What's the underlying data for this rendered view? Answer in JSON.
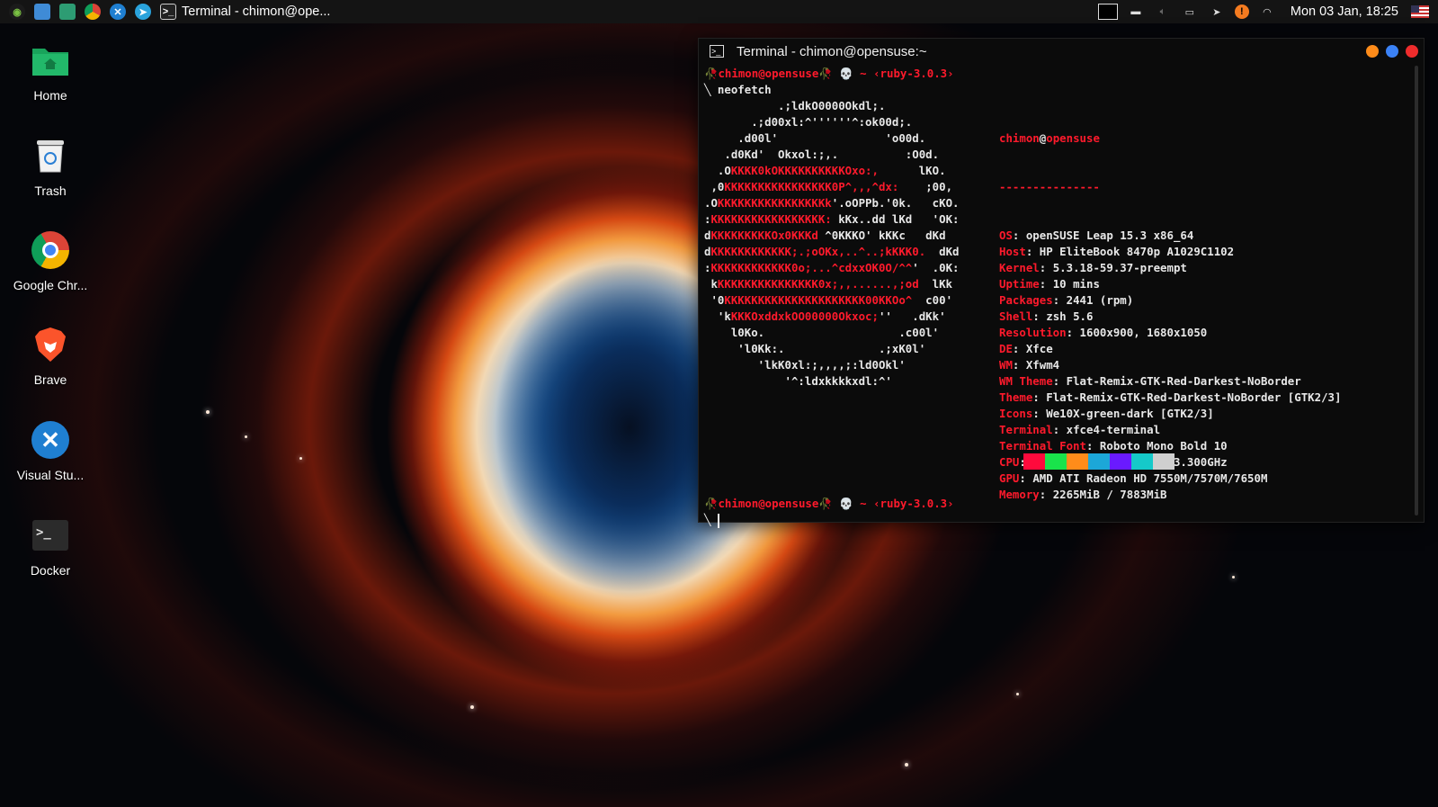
{
  "taskbar": {
    "task_title": "Terminal - chimon@ope...",
    "clock": "Mon 03 Jan, 18:25",
    "launchers": [
      "opensuse-icon",
      "file-manager-icon",
      "software-icon",
      "chrome-icon",
      "vscode-icon",
      "telegram-icon",
      "terminal-icon"
    ],
    "tray": [
      "window-icon",
      "screen-icon",
      "volume-icon",
      "battery-icon",
      "send-icon",
      "update-alert-icon",
      "wifi-icon"
    ]
  },
  "desktop": {
    "icons": [
      {
        "label": "Home",
        "icon": "folder-home-icon"
      },
      {
        "label": "Trash",
        "icon": "trash-icon"
      },
      {
        "label": "Google Chr...",
        "icon": "chrome-icon"
      },
      {
        "label": "Brave",
        "icon": "brave-icon"
      },
      {
        "label": "Visual Stu...",
        "icon": "vscode-icon"
      },
      {
        "label": "Docker",
        "icon": "terminal-app-icon"
      }
    ]
  },
  "terminal": {
    "title": "Terminal - chimon@opensuse:~",
    "prompt": {
      "user": "chimon@opensuse",
      "path": "~",
      "ruby": "‹ruby-3.0.3›",
      "command": "neofetch"
    },
    "ascii_lines": [
      "           .;ldkO0000Okdl;.",
      "       .;d00xl:^''''''^:ok00d;.",
      "     .d00l'                'o00d.",
      "   .d0Kd'  Okxol:;,.          :O0d.",
      "  .OKKKK0kOKKKKKKKKKKOxo:,      lKO.",
      " ,0KKKKKKKKKKKKKKKK0P^,,,^dx:    ;00,",
      ".OKKKKKKKKKKKKKKKKk'.oOPPb.'0k.   cKO.",
      ":KKKKKKKKKKKKKKKKK: kKx..dd lKd   'OK:",
      "dKKKKKKKKKOx0KKKd ^0KKKO' kKKc   dKd",
      "dKKKKKKKKKKKK;.;oOKx,..^..;kKKK0.  dKd",
      ":KKKKKKKKKKKK0o;...^cdxxOK0O/^^'  .0K:",
      " kKKKKKKKKKKKKKKK0x;,,......,;od  lKk",
      " '0KKKKKKKKKKKKKKKKKKKKK00KKOo^  c00'",
      "  'kKKKOxddxkOO00000Okxoc;''   .dKk'",
      "    l0Ko.                    .c00l'",
      "     'l0Kk:.              .;xK0l'",
      "        'lkK0xl:;,,,,;:ld0Okl'",
      "            '^:ldxkkkkxdl:^'"
    ],
    "info": {
      "header_user": "chimon",
      "header_host": "opensuse",
      "separator": "---------------",
      "rows": [
        {
          "key": "OS",
          "value": "openSUSE Leap 15.3 x86_64"
        },
        {
          "key": "Host",
          "value": "HP EliteBook 8470p A1029C1102"
        },
        {
          "key": "Kernel",
          "value": "5.3.18-59.37-preempt"
        },
        {
          "key": "Uptime",
          "value": "10 mins"
        },
        {
          "key": "Packages",
          "value": "2441 (rpm)"
        },
        {
          "key": "Shell",
          "value": "zsh 5.6"
        },
        {
          "key": "Resolution",
          "value": "1600x900, 1680x1050"
        },
        {
          "key": "DE",
          "value": "Xfce"
        },
        {
          "key": "WM",
          "value": "Xfwm4"
        },
        {
          "key": "WM Theme",
          "value": "Flat-Remix-GTK-Red-Darkest-NoBorder"
        },
        {
          "key": "Theme",
          "value": "Flat-Remix-GTK-Red-Darkest-NoBorder [GTK2/3]"
        },
        {
          "key": "Icons",
          "value": "We10X-green-dark [GTK2/3]"
        },
        {
          "key": "Terminal",
          "value": "xfce4-terminal"
        },
        {
          "key": "Terminal Font",
          "value": "Roboto Mono Bold 10"
        },
        {
          "key": "CPU",
          "value": "Intel i5-3320M (4) @ 3.300GHz"
        },
        {
          "key": "GPU",
          "value": "AMD ATI Radeon HD 7550M/7570M/7650M"
        },
        {
          "key": "Memory",
          "value": "2265MiB / 7883MiB"
        }
      ]
    },
    "palette": [
      "#ff0a3c",
      "#19e34b",
      "#ff8c1a",
      "#1ca7d8",
      "#6a1aff",
      "#15c9c9",
      "#cfcfcf"
    ],
    "window_buttons": [
      {
        "name": "minimize",
        "color": "#ff8c1a"
      },
      {
        "name": "maximize",
        "color": "#3b82f6"
      },
      {
        "name": "close",
        "color": "#ef2c2c"
      }
    ]
  }
}
